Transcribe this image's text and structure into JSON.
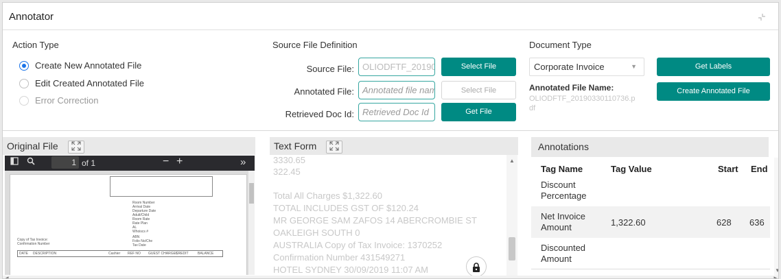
{
  "window": {
    "title": "Annotator"
  },
  "action_type": {
    "label": "Action Type",
    "options": [
      {
        "label": "Create New Annotated File",
        "selected": true,
        "disabled": false
      },
      {
        "label": "Edit Created Annotated File",
        "selected": false,
        "disabled": false
      },
      {
        "label": "Error Correction",
        "selected": false,
        "disabled": true
      }
    ]
  },
  "source_file_definition": {
    "label": "Source File Definition",
    "source_file": {
      "label": "Source File:",
      "value": "OLIODFTF_20190",
      "button": "Select File"
    },
    "annotated_file": {
      "label": "Annotated File:",
      "placeholder": "Annotated file nam",
      "button": "Select File"
    },
    "retrieved_doc": {
      "label": "Retrieved Doc Id:",
      "placeholder": "Retrieved Doc Id",
      "button": "Get File"
    }
  },
  "document_type": {
    "label": "Document Type",
    "selected": "Corporate Invoice",
    "get_labels_button": "Get Labels",
    "annotated_file_name_label": "Annotated File Name:",
    "annotated_file_name_value": "OLIODFTF_20190330110736.pdf",
    "create_button": "Create Annotated File"
  },
  "original_file": {
    "label": "Original File",
    "page_current": "1",
    "page_total": "of 1",
    "doc_lines": [
      "Room Number",
      "Arrival Date",
      "Departure Date",
      "Adult/Child",
      "Room Rate",
      "Rate Plan",
      "AL",
      "Whoiscs #",
      "ABN",
      "Folio No/Che",
      "Tax Date",
      "Copy of Tax Invoice:",
      "Confirmation Number"
    ],
    "table_headers": [
      "DATE",
      "DESCRIPTION",
      "Cashier",
      "REF NO",
      "GUEST CHARGES",
      "CREDIT",
      "BALANCE"
    ]
  },
  "text_form": {
    "label": "Text Form",
    "lines": [
      "3330.65",
      "322.45",
      "Total All Charges $1,322.60",
      "TOTAL INCLUDES GST OF $120.24",
      "MR GEORGE SAM ZAFOS 14 ABERCROMBIE ST",
      "OAKLEIGH SOUTH 0",
      "AUSTRALIA Copy of Tax Invoice: 1370252",
      "Confirmation Number 431549271",
      "HOTEL SYDNEY 30/09/2019 11:07 AM"
    ]
  },
  "annotations": {
    "label": "Annotations",
    "columns": [
      "Tag Name",
      "Tag Value",
      "Start",
      "End"
    ],
    "rows": [
      {
        "tag_name": "Discount Percentage",
        "tag_value": "",
        "start": "",
        "end": ""
      },
      {
        "tag_name": "Net Invoice Amount",
        "tag_value": "1,322.60",
        "start": "628",
        "end": "636"
      },
      {
        "tag_name": "Discounted Amount",
        "tag_value": "",
        "start": "",
        "end": ""
      }
    ]
  },
  "icons": {
    "minimize": "minimize-icon",
    "expand": "expand-icon",
    "sidebar": "sidebar-toggle-icon",
    "search": "search-icon",
    "lock": "lock-icon"
  },
  "colors": {
    "accent": "#008a83",
    "radio": "#1a73e8",
    "input_border": "#35a6a0"
  }
}
